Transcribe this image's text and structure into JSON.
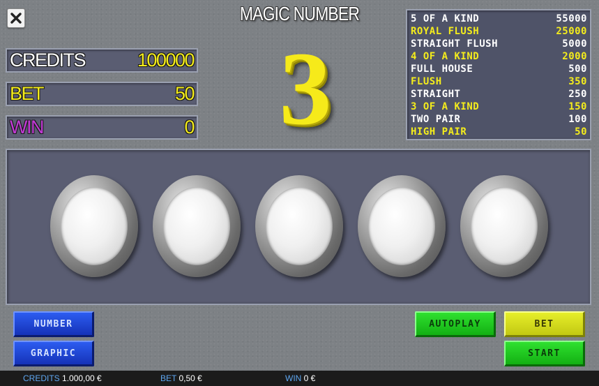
{
  "title": "MAGIC NUMBER",
  "close_icon": "close-icon",
  "magic_number": "3",
  "stats": {
    "credits": {
      "label": "CREDITS",
      "value": "100000",
      "label_color": "#ffffff",
      "value_color": "#f4ec1c"
    },
    "bet": {
      "label": "BET",
      "value": "50",
      "label_color": "#f4ec1c",
      "value_color": "#f4ec1c"
    },
    "win": {
      "label": "WIN",
      "value": "0",
      "label_color": "#c23ad6",
      "value_color": "#f4ec1c"
    }
  },
  "paytable": [
    {
      "hand": "5 OF A KIND",
      "payout": "55000",
      "color": "#ffffff"
    },
    {
      "hand": "ROYAL FLUSH",
      "payout": "25000",
      "color": "#f4ec1c"
    },
    {
      "hand": "STRAIGHT FLUSH",
      "payout": "5000",
      "color": "#ffffff"
    },
    {
      "hand": "4 OF A KIND",
      "payout": "2000",
      "color": "#f4ec1c"
    },
    {
      "hand": "FULL HOUSE",
      "payout": "500",
      "color": "#ffffff"
    },
    {
      "hand": "FLUSH",
      "payout": "350",
      "color": "#f4ec1c"
    },
    {
      "hand": "STRAIGHT",
      "payout": "250",
      "color": "#ffffff"
    },
    {
      "hand": "3 OF A KIND",
      "payout": "150",
      "color": "#f4ec1c"
    },
    {
      "hand": "TWO PAIR",
      "payout": "100",
      "color": "#ffffff"
    },
    {
      "hand": "HIGH PAIR",
      "payout": "50",
      "color": "#f4ec1c"
    }
  ],
  "buttons": {
    "number": "NUMBER",
    "graphic": "GRAPHIC",
    "autoplay": "AUTOPLAY",
    "bet": "BET",
    "start": "START"
  },
  "status_bar": {
    "credits_label": "CREDITS",
    "credits_value": "1.000,00 €",
    "bet_label": "BET",
    "bet_value": "0,50 €",
    "win_label": "WIN",
    "win_value": "0 €"
  },
  "colors": {
    "accent_yellow": "#f4ec1c",
    "win_magenta": "#c23ad6",
    "status_label_blue": "#5ea6f0"
  }
}
